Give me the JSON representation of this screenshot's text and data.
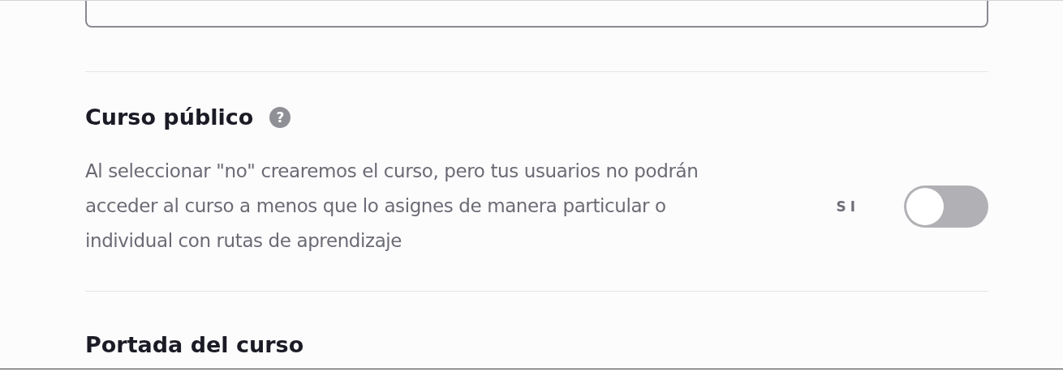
{
  "public_course": {
    "title": "Curso público",
    "help_icon": "?",
    "description": "Al seleccionar \"no\" crearemos el curso, pero tus usuarios no podrán acceder al curso a menos que lo asignes de manera particular o individual con rutas de aprendizaje",
    "toggle_label": "SI",
    "toggle": {
      "on": false
    }
  },
  "cover": {
    "title": "Portada del curso"
  }
}
